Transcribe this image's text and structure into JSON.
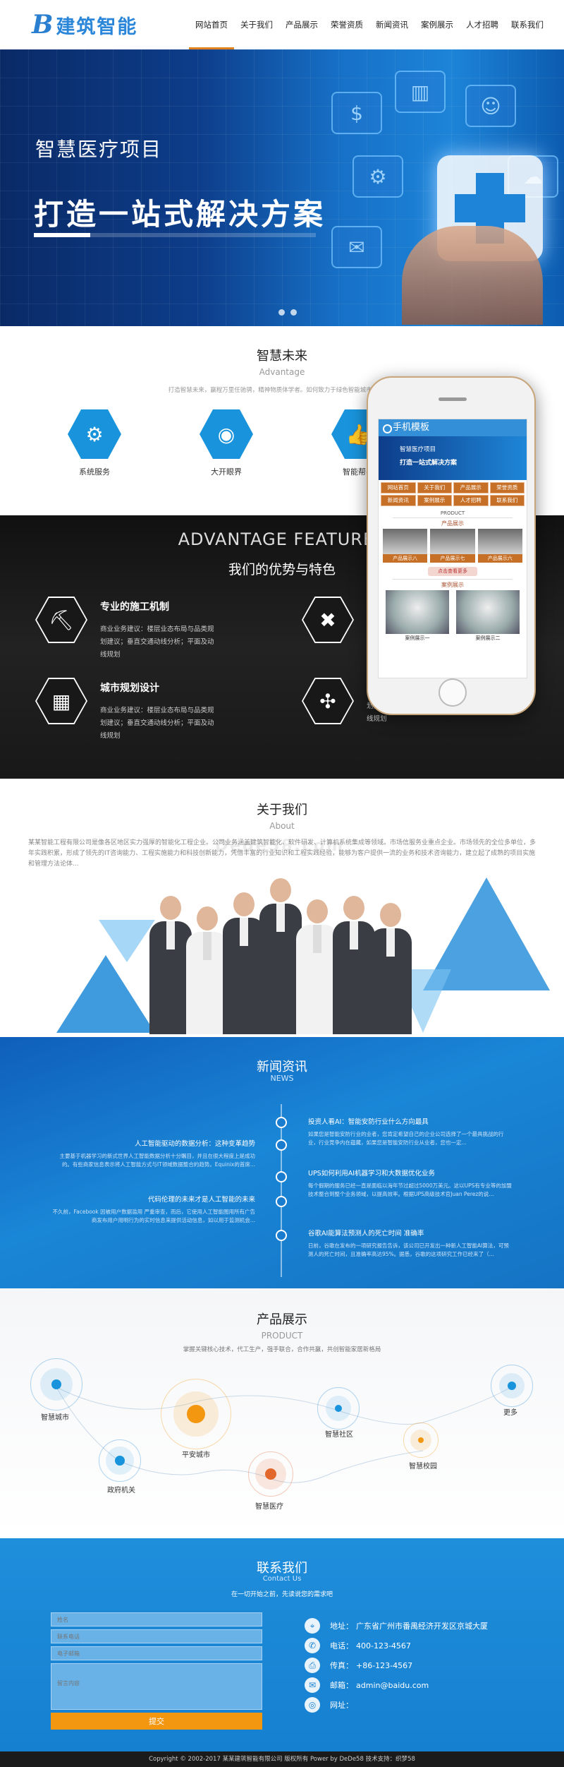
{
  "header": {
    "logo_mark": "B",
    "logo_text": "建筑智能",
    "nav": [
      {
        "label": "网站首页",
        "active": true
      },
      {
        "label": "关于我们"
      },
      {
        "label": "产品展示"
      },
      {
        "label": "荣誉资质"
      },
      {
        "label": "新闻资讯"
      },
      {
        "label": "案例展示"
      },
      {
        "label": "人才招聘"
      },
      {
        "label": "联系我们"
      }
    ]
  },
  "banner": {
    "subtitle": "智慧医疗项目",
    "title": "打造一站式解决方案",
    "slide_count": 2
  },
  "advantage": {
    "title": "智慧未来",
    "subtitle": "Advantage",
    "desc": "打造智慧未来，赢程万里任驰骋，精神物质体学者。如何致力于绿色智能城市，智能...",
    "items": [
      {
        "label": "系统服务",
        "icon": "gear-icon"
      },
      {
        "label": "大开眼界",
        "icon": "eye-icon"
      },
      {
        "label": "智能帮手",
        "icon": "thumbs-up-icon"
      }
    ]
  },
  "feature": {
    "en_title": "ADVANTAGE FEATURES",
    "cn_title": "我们的优势与特色",
    "items": [
      {
        "title": "专业的施工机制",
        "text": "商业业务建议：楼层业态布局与品类规划建议；垂直交通动线分析；平面及动线规划",
        "icon": "crane-icon"
      },
      {
        "title": "",
        "text": "",
        "icon": "tools-icon"
      },
      {
        "title": "城市规划设计",
        "text": "商业业务建议：楼层业态布局与品类规划建议；垂直交通动线分析；平面及动线规划",
        "icon": "buildings-icon"
      },
      {
        "title": "",
        "text": "商业业务建议：楼层业态布局与品类规划建议；垂直交通动线分析；平面及动线规划",
        "icon": "wind-turbine-icon"
      }
    ]
  },
  "phone": {
    "title": "手机模板",
    "banner_line1": "智慧医疗项目",
    "banner_line2": "打造一站式解决方案",
    "nav": [
      "网站首页",
      "关于我们",
      "产品展示",
      "荣誉资质",
      "新闻资讯",
      "案例展示",
      "人才招聘",
      "联系我们"
    ],
    "product_en": "PRODUCT",
    "product_cn": "产品展示",
    "products": [
      "产品展示八",
      "产品展示七",
      "产品展示六"
    ],
    "more": "点击查看更多",
    "cases_title": "案例展示",
    "cases": [
      "案例展示一",
      "案例展示二"
    ]
  },
  "about": {
    "title": "关于我们",
    "subtitle": "About",
    "text": "某某智能工程有限公司是像各区地区实力强厚的智能化工程企业。公司业务涵盖建筑智能化、软件研发、计算机系统集成等领域。市场信服务业重点企业。市场领先的全位多单位，多年实践积累，形成了领先的IT咨询能力、工程实施能力和科技创新能力，凭借丰富的行业知识和工程实践经验，能够为客户提供一流的业务和技术咨询能力，建立起了成熟的项目实施和管理方法论体...",
    "watermark": "Dede58.com"
  },
  "news": {
    "title": "新闻资讯",
    "subtitle": "NEWS",
    "items": [
      {
        "title": "投资人看AI：智能安防行业什么方向最具",
        "text": "如果您是智能安防行业的业者，您肯定希望自己的企业公司选择了一个最具挑战的行业，行业竞争内在蕴藏，如果您是智能安防行业从业者，您也一定..."
      },
      {
        "title": "人工智能驱动的数据分析：这种变革趋势",
        "text": "主要基于机器学习的新式世界人工智能数据分析十分瞩目，并且在很大程度上是成功的。有些商家信息表示将人工智能方式与IT领域数据整合的趋势。Equinix的首席..."
      },
      {
        "title": "UPS如何利用AI机器学习和大数据优化业务",
        "text": "每个假期的服务已经一直是面临以海年节过超过5000万美元。这以UPS有专业等的加盟技术整合到整个业务领域，以提高效率。根据UPS高级技术官Juan Perez的说..."
      },
      {
        "title": "代码伦理的未来才是人工智能的未来",
        "text": "不久前，Facebook 因被用户数据滥用 严重审查，而后，它使用人工智能图用所有广告商发布用户用明行为的实时信息来提供活动信息，如以用于监测机会..."
      },
      {
        "title": "谷歌AI能算法预测人的死亡时间 准确率",
        "text": "日前，谷歌在发布的一项研究报告告诉，该公司已开发出一种新人工智能AI算法，可预测人的死亡时间，且准确率高达95%。据悉，谷歌的这项研究工作已经来了（..."
      }
    ]
  },
  "product": {
    "title": "产品展示",
    "subtitle": "PRODUCT",
    "desc": "掌握关键核心技术，代工生产，强手联合，合作共赢，共创智能家居新格局",
    "items": [
      {
        "label": "智慧城市",
        "color": "#1994dc"
      },
      {
        "label": "政府机关",
        "color": "#1994dc"
      },
      {
        "label": "平安城市",
        "color": "#f39711"
      },
      {
        "label": "智慧医疗",
        "color": "#e2672a"
      },
      {
        "label": "智慧社区",
        "color": "#1994dc"
      },
      {
        "label": "智慧校园",
        "color": "#f39711"
      },
      {
        "label": "更多",
        "color": "#1994dc"
      }
    ]
  },
  "contact": {
    "title": "联系我们",
    "subtitle": "Contact Us",
    "desc": "在一切开始之前，先读说您的需求吧",
    "form": {
      "name": "姓名",
      "phone": "联系电话",
      "email": "电子邮箱",
      "message": "留言内容",
      "submit": "提交"
    },
    "info": [
      {
        "key": "地址：",
        "value": "广东省广州市番禺经济开发区京城大厦",
        "icon": "location-icon"
      },
      {
        "key": "电话：",
        "value": "400-123-4567",
        "icon": "phone-icon"
      },
      {
        "key": "传真：",
        "value": "+86-123-4567",
        "icon": "fax-icon"
      },
      {
        "key": "邮箱：",
        "value": "admin@baidu.com",
        "icon": "mail-icon"
      },
      {
        "key": "网址：",
        "value": "",
        "icon": "globe-icon"
      }
    ]
  },
  "footer": {
    "text": "Copyright © 2002-2017 某某建筑智能有限公司 版权所有 Power by DeDe58   技术支持：织梦58"
  }
}
